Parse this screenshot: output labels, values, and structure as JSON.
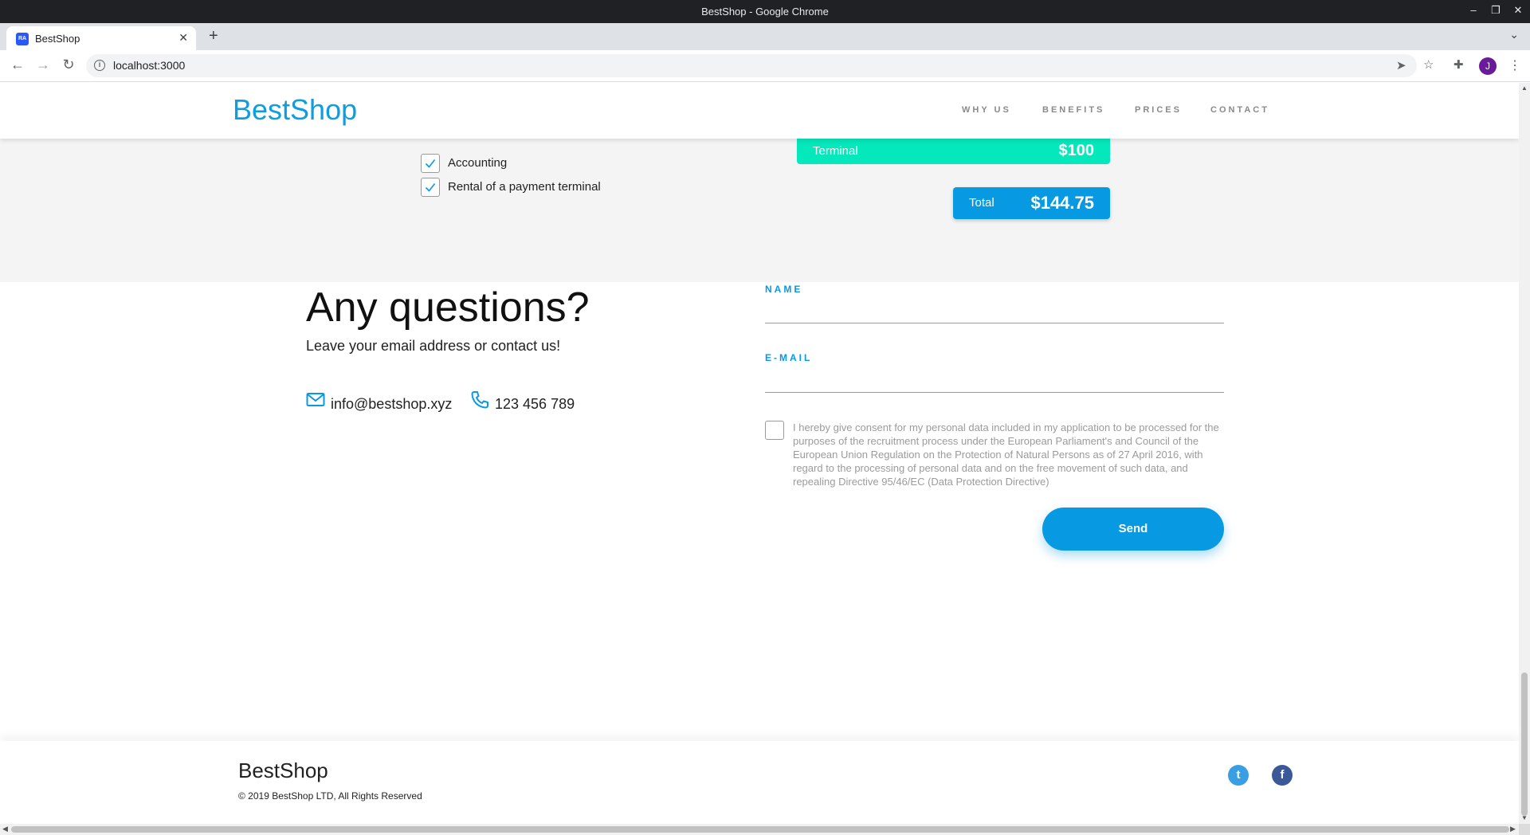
{
  "window": {
    "title": "BestShop - Google Chrome"
  },
  "browser": {
    "tab_title": "BestShop",
    "favicon_text": "RA",
    "url": "localhost:3000",
    "profile_initial": "J"
  },
  "header": {
    "logo": "BestShop",
    "nav": [
      "WHY US",
      "BENEFITS",
      "PRICES",
      "CONTACT"
    ]
  },
  "calculator": {
    "checkboxes": [
      {
        "label": "Accounting",
        "checked": true
      },
      {
        "label": "Rental of a payment terminal",
        "checked": true
      }
    ],
    "terminal": {
      "label": "Terminal",
      "value": "$100"
    },
    "total": {
      "label": "Total",
      "value": "$144.75"
    },
    "colors": {
      "terminal": "#05e8bc",
      "accent": "#0899e3"
    }
  },
  "contact": {
    "title": "Any questions?",
    "subtitle": "Leave your email address or contact us!",
    "email": "info@bestshop.xyz",
    "phone": "123 456 789",
    "form": {
      "name_label": "NAME",
      "email_label": "E-MAIL",
      "consent_text": "I hereby give consent for my personal data included in my application to be processed for the purposes of the recruitment process under the European Parliament's and Council of the European Union Regulation on the Protection of Natural Persons as of 27 April 2016, with regard to the processing of personal data and on the free movement of such data, and repealing Directive 95/46/EC (Data Protection Directive)",
      "consent_checked": false,
      "send_label": "Send"
    }
  },
  "footer": {
    "logo": "BestShop",
    "copyright": "© 2019 BestShop LTD, All Rights Reserved",
    "social": [
      {
        "name": "twitter",
        "icon": "twitter-icon"
      },
      {
        "name": "facebook",
        "icon": "facebook-icon"
      }
    ]
  }
}
